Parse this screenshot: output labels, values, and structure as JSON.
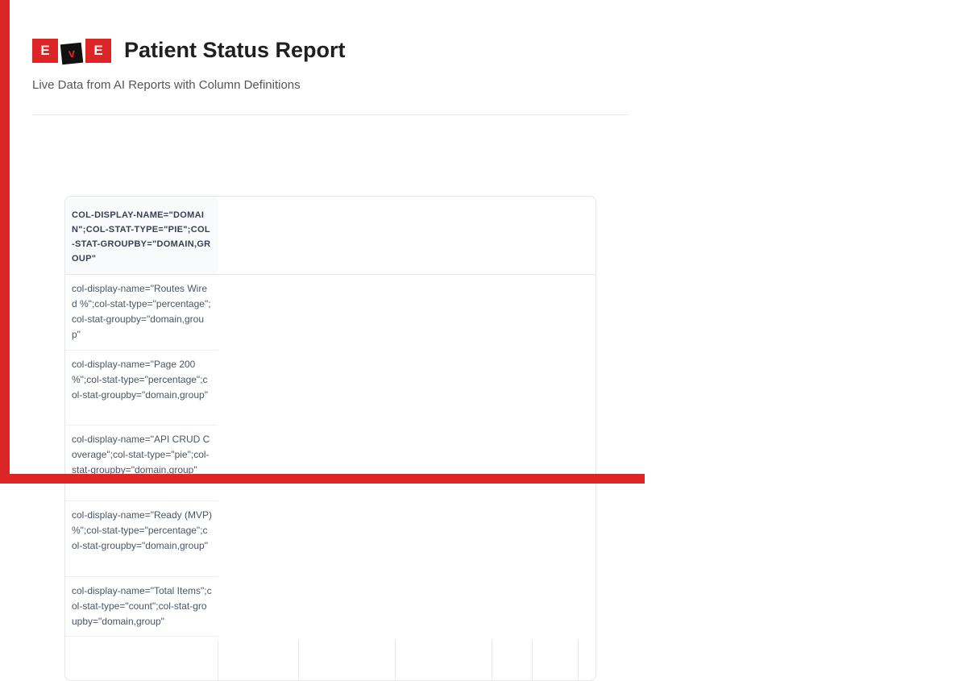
{
  "header": {
    "logo_letters": [
      "E",
      "v",
      "E"
    ],
    "title": "Patient Status Report",
    "subtitle": "Live Data from AI Reports with Column Definitions"
  },
  "table": {
    "column_header": "col-display-name=\"domain\";col-stat-type=\"pie\";col-stat-groupby=\"domain,group\"",
    "rows": [
      "col-display-name=\"Routes Wired %\";col-stat-type=\"percentage\";col-stat-groupby=\"domain,group\"",
      "col-display-name=\"Page 200 %\";col-stat-type=\"percentage\";col-stat-groupby=\"domain,group\"",
      "col-display-name=\"API CRUD Coverage\";col-stat-type=\"pie\";col-stat-groupby=\"domain,group\"",
      "col-display-name=\"Ready (MVP) %\";col-stat-type=\"percentage\";col-stat-groupby=\"domain,group\"",
      "col-display-name=\"Total Items\";col-stat-type=\"count\";col-stat-groupby=\"domain,group\""
    ]
  },
  "colors": {
    "brand": "#dc2626"
  }
}
